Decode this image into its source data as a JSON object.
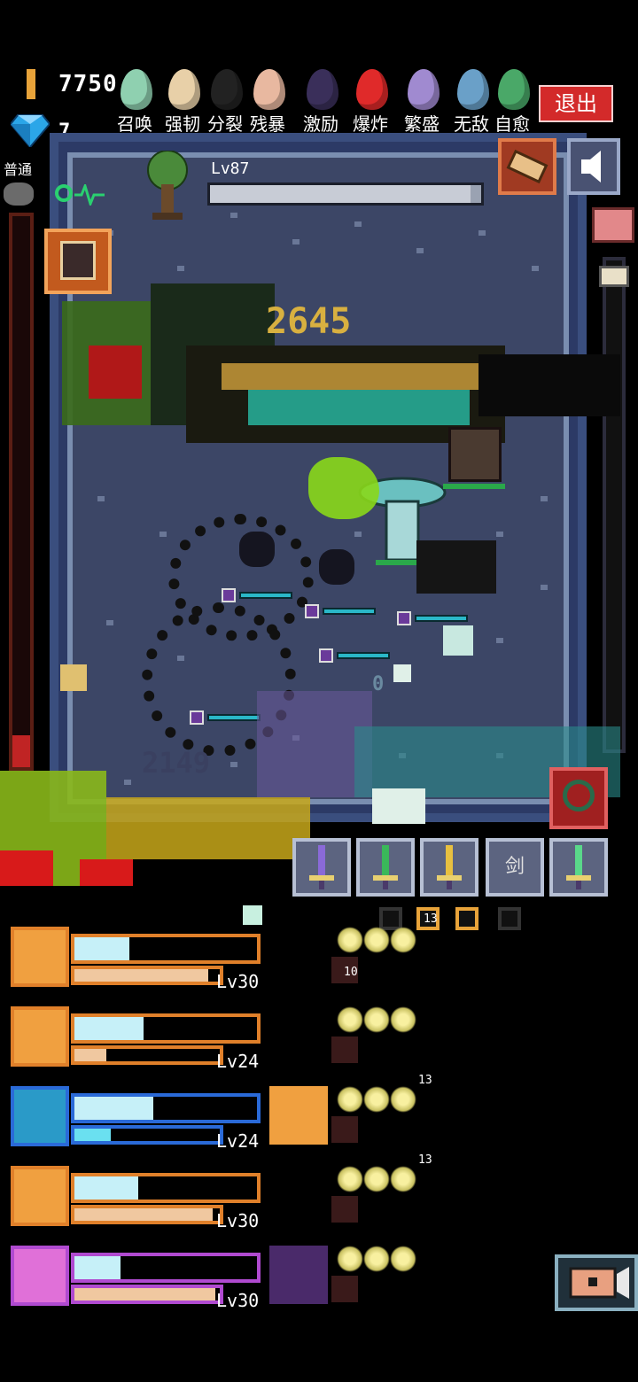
{
  "header": {
    "gold": "7750",
    "gems": "7",
    "exit_label": "退出",
    "mode_label": "普通"
  },
  "eggs": [
    {
      "label": "召唤",
      "color": "#8fd0b0"
    },
    {
      "label": "强韧",
      "color": "#e8d0a8"
    },
    {
      "label": "分裂",
      "color": "#222222"
    },
    {
      "label": "残暴",
      "color": "#e8b8a0"
    },
    {
      "label": "激励",
      "color": "#3a2f5a"
    },
    {
      "label": "爆炸",
      "color": "#e02a2a"
    },
    {
      "label": "繁盛",
      "color": "#a08ad0"
    },
    {
      "label": "无敌",
      "color": "#6aa0c8"
    },
    {
      "label": "自愈",
      "color": "#4aa868"
    }
  ],
  "boss": {
    "level": "Lv87",
    "hp_fraction": 0.96
  },
  "damage_texts": [
    "2645",
    "2149",
    "0"
  ],
  "weapons": [
    {
      "name": "purple-sword",
      "label": ""
    },
    {
      "name": "green-sword",
      "label": ""
    },
    {
      "name": "holy-sword",
      "label": ""
    },
    {
      "name": "empty-sword-slot",
      "label": "剑"
    },
    {
      "name": "green-axe",
      "label": ""
    }
  ],
  "heroes": [
    {
      "level": "Lv30",
      "hp_fraction": 0.3,
      "xp_fraction": 0.92,
      "theme": "#e0802a"
    },
    {
      "level": "Lv24",
      "hp_fraction": 0.38,
      "xp_fraction": 0.22,
      "theme": "#e0802a"
    },
    {
      "level": "Lv24",
      "hp_fraction": 0.43,
      "xp_fraction": 0.25,
      "theme": "#2a6ad8"
    },
    {
      "level": "Lv30",
      "hp_fraction": 0.35,
      "xp_fraction": 0.95,
      "theme": "#e0802a"
    },
    {
      "level": "Lv30",
      "hp_fraction": 0.25,
      "xp_fraction": 0.97,
      "theme": "#b04ad0"
    }
  ],
  "skill_counts": [
    "13",
    "10",
    "13",
    "13"
  ],
  "colors": {
    "gold": "#e8a33a",
    "exit": "#d32a2a",
    "arena": "#3c4666",
    "hp_fill": "#c6f0f8"
  }
}
